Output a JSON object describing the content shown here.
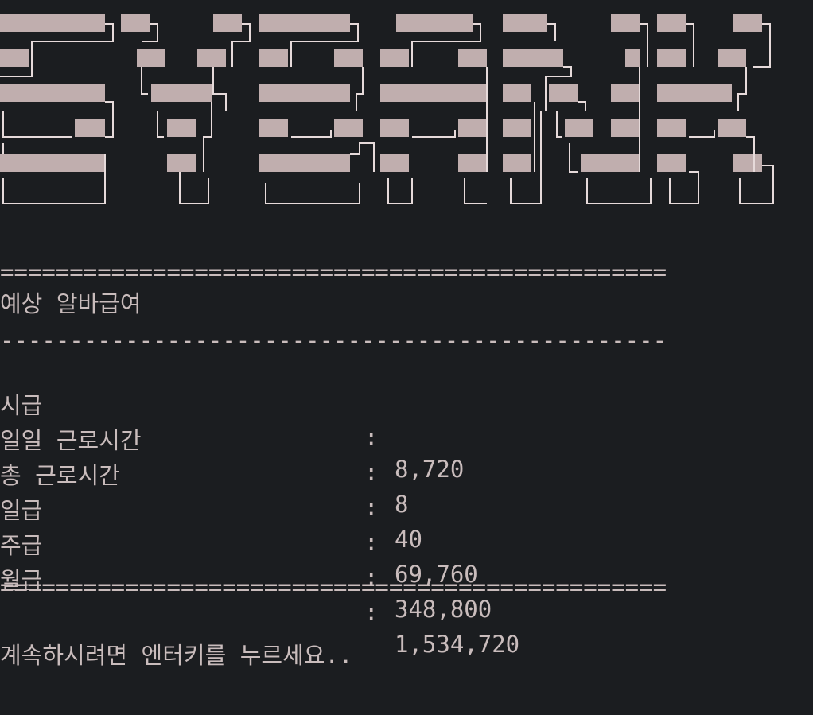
{
  "banner": {
    "text_icon": "ascii-art-banner",
    "color": "#c0aeae",
    "edge_color": "#e6dada"
  },
  "rules": {
    "double": "================================================",
    "single": "------------------------------------------------"
  },
  "section_title": "예상 알바급여",
  "rows": [
    {
      "label": "시급",
      "colon": ":",
      "value": "8,720"
    },
    {
      "label": "일일 근로시간",
      "colon": ":",
      "value": "8"
    },
    {
      "label": "총 근로시간",
      "colon": ":",
      "value": "40"
    },
    {
      "label": "일급",
      "colon": ":",
      "value": "69,760"
    },
    {
      "label": "주급",
      "colon": ":",
      "value": "348,800"
    },
    {
      "label": "월급",
      "colon": ":",
      "value": "1,534,720"
    }
  ],
  "prompt": "계속하시려면 엔터키를 누르세요..",
  "colors": {
    "background": "#1b1d20",
    "foreground": "#c9bcbc"
  }
}
